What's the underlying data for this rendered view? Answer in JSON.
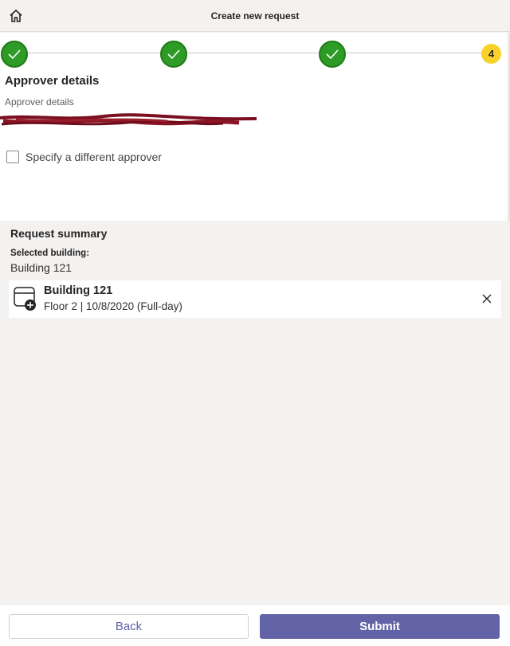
{
  "header": {
    "title": "Create new request",
    "home_icon": "home-icon"
  },
  "stepper": {
    "steps": [
      {
        "state": "completed",
        "icon": "checkmark-icon"
      },
      {
        "state": "completed",
        "icon": "checkmark-icon"
      },
      {
        "state": "completed",
        "icon": "checkmark-icon"
      },
      {
        "state": "current",
        "label": "4"
      }
    ],
    "colors": {
      "completed": "#2d9b25",
      "current": "#f8d22a",
      "line": "#c8c6c4"
    }
  },
  "approver": {
    "section_title": "Approver details",
    "field_label": "Approver details",
    "checkbox_label": "Specify a different approver",
    "checkbox_checked": false
  },
  "summary": {
    "title": "Request summary",
    "selected_building_label": "Selected building:",
    "selected_building_value": "Building 121",
    "card": {
      "title": "Building 121",
      "subtitle": "Floor 2 | 10/8/2020 (Full-day)",
      "icon": "calendar-add-icon",
      "close_icon": "close-icon"
    }
  },
  "footer": {
    "back_label": "Back",
    "submit_label": "Submit"
  },
  "colors": {
    "accent": "#6264a7",
    "background": "#f3f2f1",
    "redaction": "#7a1020"
  }
}
